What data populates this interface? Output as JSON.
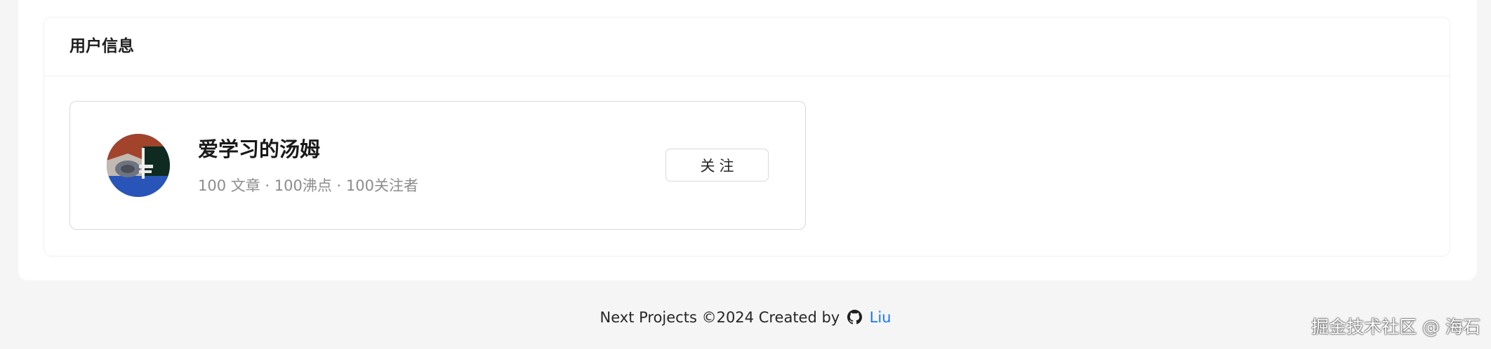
{
  "card": {
    "title": "用户信息"
  },
  "user": {
    "name": "爱学习的汤姆",
    "stats": "100 文章 · 100沸点 · 100关注者",
    "follow_label": "关注"
  },
  "footer": {
    "text": "Next Projects ©2024 Created by",
    "author": "Liu",
    "author_icon": "github-icon"
  },
  "watermark": "掘金技术社区 @ 海石",
  "colors": {
    "page_bg": "#f5f5f5",
    "panel_bg": "#ffffff",
    "link": "#1677ff",
    "muted_text": "#8c8c8c"
  }
}
